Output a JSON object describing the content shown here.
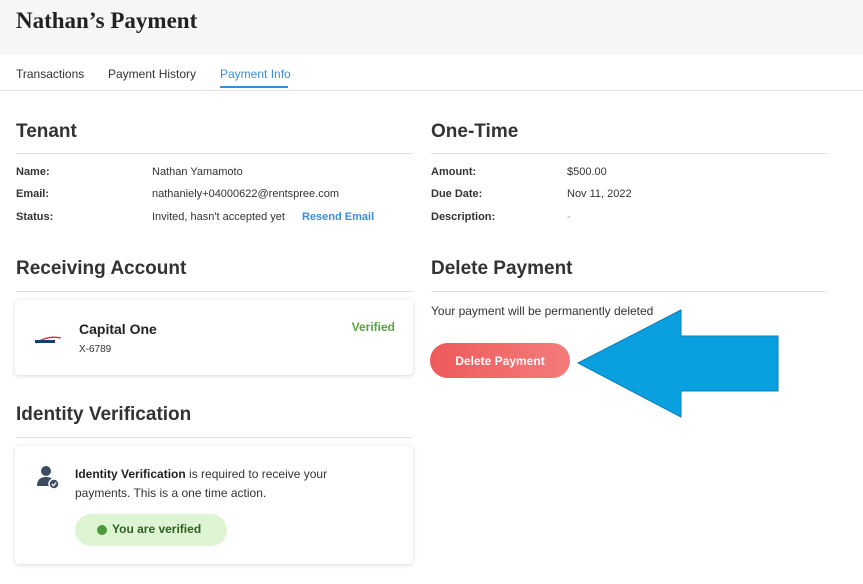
{
  "header": {
    "title": "Nathan’s Payment"
  },
  "tabs": [
    {
      "label": "Transactions"
    },
    {
      "label": "Payment History"
    },
    {
      "label": "Payment Info"
    }
  ],
  "tenant": {
    "title": "Tenant",
    "name_label": "Name:",
    "name_value": "Nathan Yamamoto",
    "email_label": "Email:",
    "email_value": "nathaniely+04000622@rentspree.com",
    "status_label": "Status:",
    "status_value": "Invited, hasn't accepted yet",
    "resend_link": "Resend Email"
  },
  "one_time": {
    "title": "One-Time",
    "amount_label": "Amount:",
    "amount_value": "$500.00",
    "due_label": "Due Date:",
    "due_value": "Nov 11, 2022",
    "description_label": "Description:",
    "description_value": "-"
  },
  "receiving": {
    "title": "Receiving Account",
    "bank_name": "Capital One",
    "account_number": "X-6789",
    "status": "Verified",
    "logo_text": "Capital One"
  },
  "delete": {
    "title": "Delete Payment",
    "description": "Your payment will be permanently deleted",
    "button_label": "Delete Payment"
  },
  "identity": {
    "title": "Identity Verification",
    "bold_text": "Identity Verification",
    "rest_text": " is required to receive your payments. This is a one time action.",
    "verified_label": "You are verified"
  },
  "colors": {
    "accent": "#3c8dd9",
    "danger": "#ee5a5a",
    "success": "#5aa33e",
    "annotation_arrow": "#0aa0df"
  }
}
